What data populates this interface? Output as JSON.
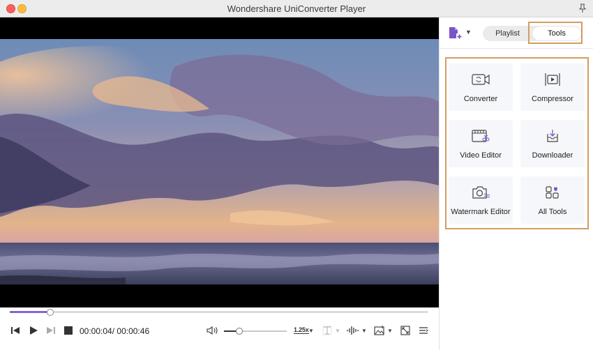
{
  "window": {
    "title": "Wondershare UniConverter Player"
  },
  "player": {
    "current_time": "00:00:04",
    "duration": "00:00:46",
    "time_separator": "/",
    "progress_fraction": 0.097,
    "volume_fraction": 0.24,
    "speed_label": "1.25x"
  },
  "panel": {
    "tabs": {
      "playlist": "Playlist",
      "tools": "Tools"
    },
    "active_tab": "Tools",
    "tools": [
      {
        "label": "Converter",
        "icon": "converter-icon"
      },
      {
        "label": "Compressor",
        "icon": "compressor-icon"
      },
      {
        "label": "Video Editor",
        "icon": "video-editor-icon"
      },
      {
        "label": "Downloader",
        "icon": "downloader-icon"
      },
      {
        "label": "Watermark Editor",
        "icon": "watermark-editor-icon"
      },
      {
        "label": "All Tools",
        "icon": "all-tools-icon"
      }
    ]
  },
  "colors": {
    "accent": "#8a63d2",
    "highlight": "#d39d5f"
  }
}
